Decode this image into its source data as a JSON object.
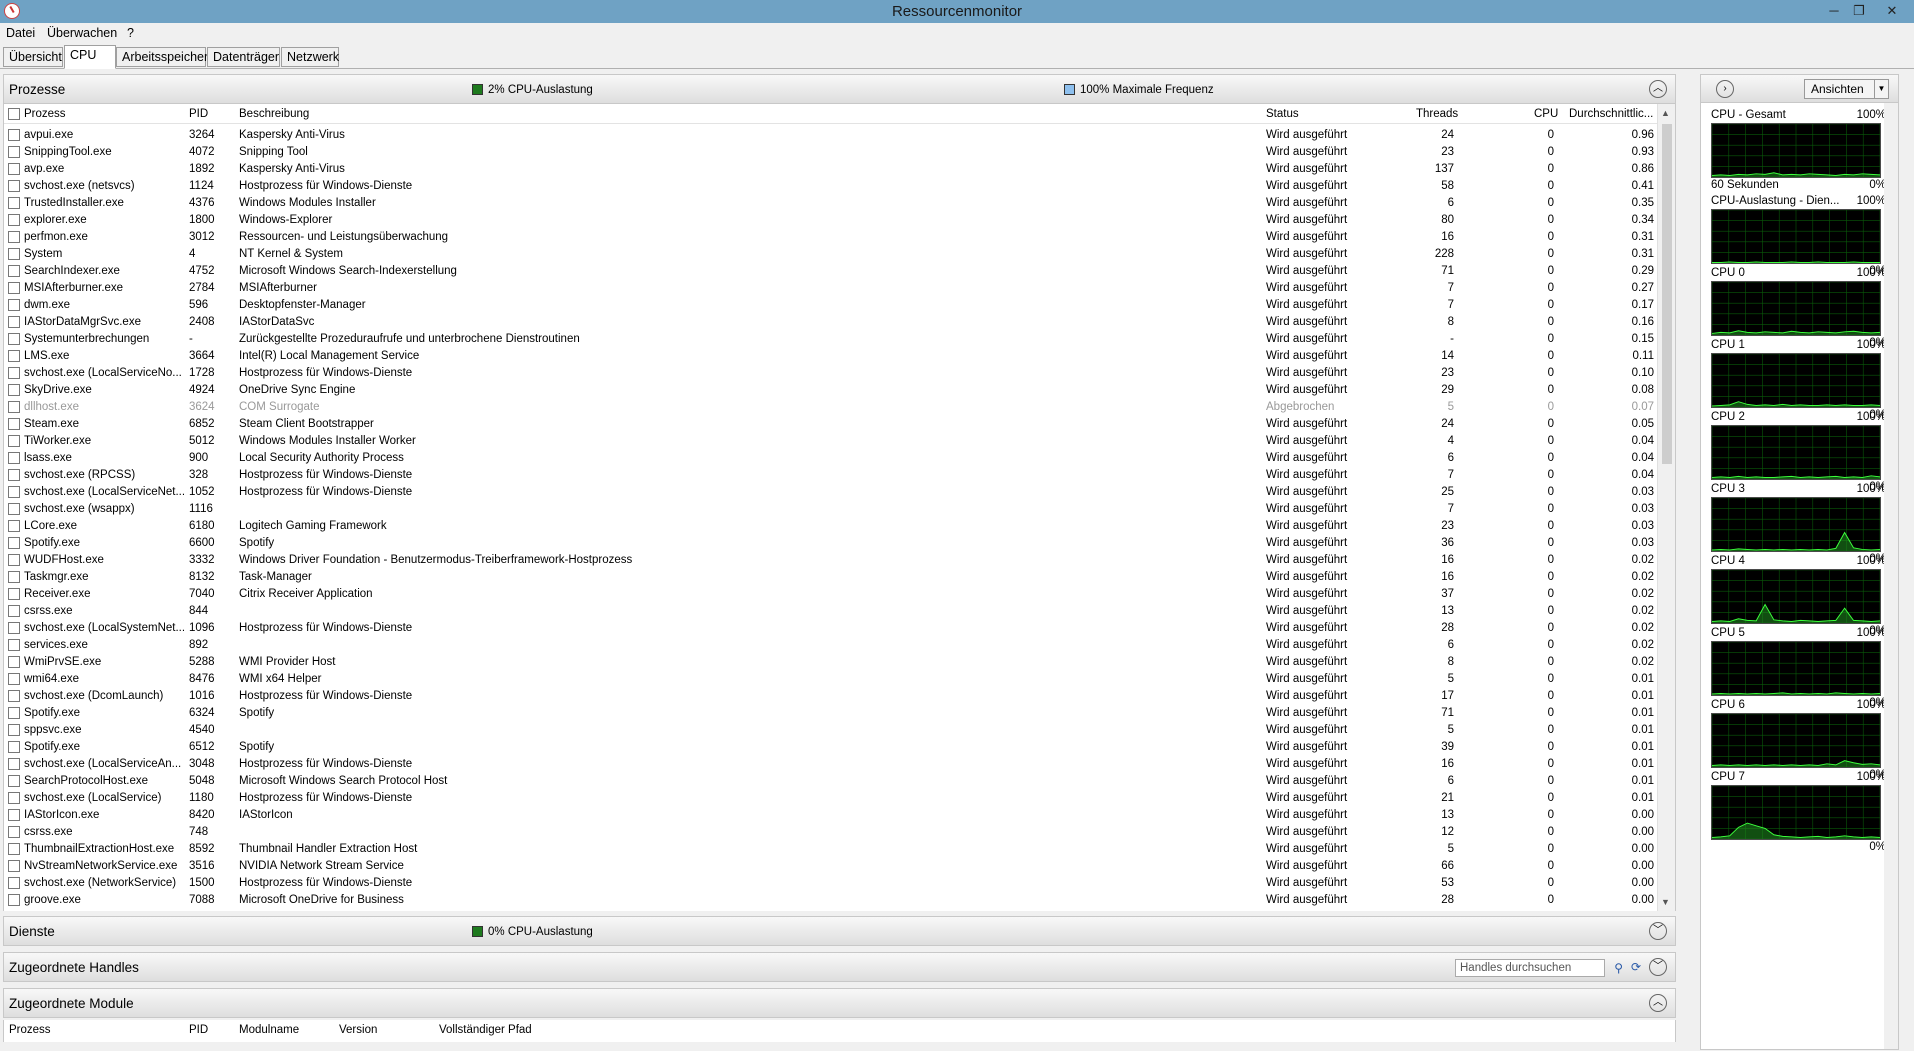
{
  "window": {
    "title": "Ressourcenmonitor",
    "minimize": "─",
    "restore": "❐",
    "close": "✕"
  },
  "menu": {
    "datei": "Datei",
    "ueberwachen": "Überwachen",
    "help": "?"
  },
  "tabs": {
    "uebersicht": "Übersicht",
    "cpu": "CPU",
    "arbeitsspeicher": "Arbeitsspeicher",
    "datentraeger": "Datenträger",
    "netzwerk": "Netzwerk"
  },
  "prozesse": {
    "title": "Prozesse",
    "cpu_load": "2% CPU-Auslastung",
    "max_freq": "100% Maximale Frequenz",
    "legend_colors": {
      "cpu": "#1e7a1e",
      "freq": "#8ec0ee"
    },
    "columns": {
      "prozess": "Prozess",
      "pid": "PID",
      "beschreibung": "Beschreibung",
      "status": "Status",
      "threads": "Threads",
      "cpu": "CPU",
      "avg": "Durchschnittlic..."
    },
    "rows": [
      {
        "p": "avpui.exe",
        "pid": "3264",
        "d": "Kaspersky Anti-Virus",
        "s": "Wird ausgeführt",
        "t": "24",
        "c": "0",
        "a": "0.96"
      },
      {
        "p": "SnippingTool.exe",
        "pid": "4072",
        "d": "Snipping Tool",
        "s": "Wird ausgeführt",
        "t": "23",
        "c": "0",
        "a": "0.93"
      },
      {
        "p": "avp.exe",
        "pid": "1892",
        "d": "Kaspersky Anti-Virus",
        "s": "Wird ausgeführt",
        "t": "137",
        "c": "0",
        "a": "0.86"
      },
      {
        "p": "svchost.exe (netsvcs)",
        "pid": "1124",
        "d": "Hostprozess für Windows-Dienste",
        "s": "Wird ausgeführt",
        "t": "58",
        "c": "0",
        "a": "0.41"
      },
      {
        "p": "TrustedInstaller.exe",
        "pid": "4376",
        "d": "Windows Modules Installer",
        "s": "Wird ausgeführt",
        "t": "6",
        "c": "0",
        "a": "0.35"
      },
      {
        "p": "explorer.exe",
        "pid": "1800",
        "d": "Windows-Explorer",
        "s": "Wird ausgeführt",
        "t": "80",
        "c": "0",
        "a": "0.34"
      },
      {
        "p": "perfmon.exe",
        "pid": "3012",
        "d": "Ressourcen- und Leistungsüberwachung",
        "s": "Wird ausgeführt",
        "t": "16",
        "c": "0",
        "a": "0.31"
      },
      {
        "p": "System",
        "pid": "4",
        "d": "NT Kernel & System",
        "s": "Wird ausgeführt",
        "t": "228",
        "c": "0",
        "a": "0.31"
      },
      {
        "p": "SearchIndexer.exe",
        "pid": "4752",
        "d": "Microsoft Windows Search-Indexerstellung",
        "s": "Wird ausgeführt",
        "t": "71",
        "c": "0",
        "a": "0.29"
      },
      {
        "p": "MSIAfterburner.exe",
        "pid": "2784",
        "d": "MSIAfterburner",
        "s": "Wird ausgeführt",
        "t": "7",
        "c": "0",
        "a": "0.27"
      },
      {
        "p": "dwm.exe",
        "pid": "596",
        "d": "Desktopfenster-Manager",
        "s": "Wird ausgeführt",
        "t": "7",
        "c": "0",
        "a": "0.17"
      },
      {
        "p": "IAStorDataMgrSvc.exe",
        "pid": "2408",
        "d": "IAStorDataSvc",
        "s": "Wird ausgeführt",
        "t": "8",
        "c": "0",
        "a": "0.16"
      },
      {
        "p": "Systemunterbrechungen",
        "pid": "-",
        "d": "Zurückgestellte Prozeduraufrufe und unterbrochene Dienstroutinen",
        "s": "Wird ausgeführt",
        "t": "-",
        "c": "0",
        "a": "0.15"
      },
      {
        "p": "LMS.exe",
        "pid": "3664",
        "d": "Intel(R) Local Management Service",
        "s": "Wird ausgeführt",
        "t": "14",
        "c": "0",
        "a": "0.11"
      },
      {
        "p": "svchost.exe (LocalServiceNo...",
        "pid": "1728",
        "d": "Hostprozess für Windows-Dienste",
        "s": "Wird ausgeführt",
        "t": "23",
        "c": "0",
        "a": "0.10"
      },
      {
        "p": "SkyDrive.exe",
        "pid": "4924",
        "d": "OneDrive Sync Engine",
        "s": "Wird ausgeführt",
        "t": "29",
        "c": "0",
        "a": "0.08"
      },
      {
        "p": "dllhost.exe",
        "pid": "3624",
        "d": "COM Surrogate",
        "s": "Abgebrochen",
        "t": "5",
        "c": "0",
        "a": "0.07",
        "dim": true
      },
      {
        "p": "Steam.exe",
        "pid": "6852",
        "d": "Steam Client Bootstrapper",
        "s": "Wird ausgeführt",
        "t": "24",
        "c": "0",
        "a": "0.05"
      },
      {
        "p": "TiWorker.exe",
        "pid": "5012",
        "d": "Windows Modules Installer Worker",
        "s": "Wird ausgeführt",
        "t": "4",
        "c": "0",
        "a": "0.04"
      },
      {
        "p": "lsass.exe",
        "pid": "900",
        "d": "Local Security Authority Process",
        "s": "Wird ausgeführt",
        "t": "6",
        "c": "0",
        "a": "0.04"
      },
      {
        "p": "svchost.exe (RPCSS)",
        "pid": "328",
        "d": "Hostprozess für Windows-Dienste",
        "s": "Wird ausgeführt",
        "t": "7",
        "c": "0",
        "a": "0.04"
      },
      {
        "p": "svchost.exe (LocalServiceNet...",
        "pid": "1052",
        "d": "Hostprozess für Windows-Dienste",
        "s": "Wird ausgeführt",
        "t": "25",
        "c": "0",
        "a": "0.03"
      },
      {
        "p": "svchost.exe (wsappx)",
        "pid": "1116",
        "d": "",
        "s": "Wird ausgeführt",
        "t": "7",
        "c": "0",
        "a": "0.03"
      },
      {
        "p": "LCore.exe",
        "pid": "6180",
        "d": "Logitech Gaming Framework",
        "s": "Wird ausgeführt",
        "t": "23",
        "c": "0",
        "a": "0.03"
      },
      {
        "p": "Spotify.exe",
        "pid": "6600",
        "d": "Spotify",
        "s": "Wird ausgeführt",
        "t": "36",
        "c": "0",
        "a": "0.03"
      },
      {
        "p": "WUDFHost.exe",
        "pid": "3332",
        "d": "Windows Driver Foundation - Benutzermodus-Treiberframework-Hostprozess",
        "s": "Wird ausgeführt",
        "t": "16",
        "c": "0",
        "a": "0.02"
      },
      {
        "p": "Taskmgr.exe",
        "pid": "8132",
        "d": "Task-Manager",
        "s": "Wird ausgeführt",
        "t": "16",
        "c": "0",
        "a": "0.02"
      },
      {
        "p": "Receiver.exe",
        "pid": "7040",
        "d": "Citrix Receiver Application",
        "s": "Wird ausgeführt",
        "t": "37",
        "c": "0",
        "a": "0.02"
      },
      {
        "p": "csrss.exe",
        "pid": "844",
        "d": "",
        "s": "Wird ausgeführt",
        "t": "13",
        "c": "0",
        "a": "0.02"
      },
      {
        "p": "svchost.exe (LocalSystemNet...",
        "pid": "1096",
        "d": "Hostprozess für Windows-Dienste",
        "s": "Wird ausgeführt",
        "t": "28",
        "c": "0",
        "a": "0.02"
      },
      {
        "p": "services.exe",
        "pid": "892",
        "d": "",
        "s": "Wird ausgeführt",
        "t": "6",
        "c": "0",
        "a": "0.02"
      },
      {
        "p": "WmiPrvSE.exe",
        "pid": "5288",
        "d": "WMI Provider Host",
        "s": "Wird ausgeführt",
        "t": "8",
        "c": "0",
        "a": "0.02"
      },
      {
        "p": "wmi64.exe",
        "pid": "8476",
        "d": "WMI x64 Helper",
        "s": "Wird ausgeführt",
        "t": "5",
        "c": "0",
        "a": "0.01"
      },
      {
        "p": "svchost.exe (DcomLaunch)",
        "pid": "1016",
        "d": "Hostprozess für Windows-Dienste",
        "s": "Wird ausgeführt",
        "t": "17",
        "c": "0",
        "a": "0.01"
      },
      {
        "p": "Spotify.exe",
        "pid": "6324",
        "d": "Spotify",
        "s": "Wird ausgeführt",
        "t": "71",
        "c": "0",
        "a": "0.01"
      },
      {
        "p": "sppsvc.exe",
        "pid": "4540",
        "d": "",
        "s": "Wird ausgeführt",
        "t": "5",
        "c": "0",
        "a": "0.01"
      },
      {
        "p": "Spotify.exe",
        "pid": "6512",
        "d": "Spotify",
        "s": "Wird ausgeführt",
        "t": "39",
        "c": "0",
        "a": "0.01"
      },
      {
        "p": "svchost.exe (LocalServiceAn...",
        "pid": "3048",
        "d": "Hostprozess für Windows-Dienste",
        "s": "Wird ausgeführt",
        "t": "16",
        "c": "0",
        "a": "0.01"
      },
      {
        "p": "SearchProtocolHost.exe",
        "pid": "5048",
        "d": "Microsoft Windows Search Protocol Host",
        "s": "Wird ausgeführt",
        "t": "6",
        "c": "0",
        "a": "0.01"
      },
      {
        "p": "svchost.exe (LocalService)",
        "pid": "1180",
        "d": "Hostprozess für Windows-Dienste",
        "s": "Wird ausgeführt",
        "t": "21",
        "c": "0",
        "a": "0.01"
      },
      {
        "p": "IAStorIcon.exe",
        "pid": "8420",
        "d": "IAStorIcon",
        "s": "Wird ausgeführt",
        "t": "13",
        "c": "0",
        "a": "0.00"
      },
      {
        "p": "csrss.exe",
        "pid": "748",
        "d": "",
        "s": "Wird ausgeführt",
        "t": "12",
        "c": "0",
        "a": "0.00"
      },
      {
        "p": "ThumbnailExtractionHost.exe",
        "pid": "8592",
        "d": "Thumbnail Handler Extraction Host",
        "s": "Wird ausgeführt",
        "t": "5",
        "c": "0",
        "a": "0.00"
      },
      {
        "p": "NvStreamNetworkService.exe",
        "pid": "3516",
        "d": "NVIDIA Network Stream Service",
        "s": "Wird ausgeführt",
        "t": "66",
        "c": "0",
        "a": "0.00"
      },
      {
        "p": "svchost.exe (NetworkService)",
        "pid": "1500",
        "d": "Hostprozess für Windows-Dienste",
        "s": "Wird ausgeführt",
        "t": "53",
        "c": "0",
        "a": "0.00"
      },
      {
        "p": "groove.exe",
        "pid": "7088",
        "d": "Microsoft OneDrive for Business",
        "s": "Wird ausgeführt",
        "t": "28",
        "c": "0",
        "a": "0.00"
      }
    ]
  },
  "dienste": {
    "title": "Dienste",
    "cpu_load": "0% CPU-Auslastung"
  },
  "handles": {
    "title": "Zugeordnete Handles",
    "search_placeholder": "Handles durchsuchen"
  },
  "module": {
    "title": "Zugeordnete Module",
    "columns": {
      "prozess": "Prozess",
      "pid": "PID",
      "modulname": "Modulname",
      "version": "Version",
      "pfad": "Vollständiger Pfad"
    }
  },
  "right": {
    "ansichten": "Ansichten",
    "graphs": [
      {
        "label": "CPU - Gesamt",
        "max": "100%",
        "min": "0%",
        "sub": "60 Sekunden",
        "levels": [
          3,
          4,
          3,
          5,
          4,
          6,
          5,
          8,
          4,
          5,
          4,
          6,
          5,
          4,
          3,
          5,
          4,
          6,
          5,
          4
        ]
      },
      {
        "label": "CPU-Auslastung - Dien...",
        "max": "100%",
        "min": "0%",
        "levels": [
          1,
          1,
          2,
          1,
          1,
          2,
          1,
          1,
          1,
          2,
          1,
          1,
          2,
          1,
          1,
          1,
          2,
          1,
          1,
          1
        ]
      },
      {
        "label": "CPU 0",
        "max": "100%",
        "min": "0%",
        "levels": [
          3,
          5,
          4,
          8,
          5,
          4,
          6,
          5,
          4,
          7,
          5,
          4,
          6,
          5,
          4,
          6,
          7,
          5,
          4,
          5
        ]
      },
      {
        "label": "CPU 1",
        "max": "100%",
        "min": "0%",
        "levels": [
          2,
          3,
          4,
          10,
          5,
          3,
          4,
          3,
          5,
          3,
          4,
          3,
          3,
          4,
          3,
          4,
          3,
          3,
          4,
          3
        ]
      },
      {
        "label": "CPU 2",
        "max": "100%",
        "min": "0%",
        "levels": [
          3,
          4,
          3,
          5,
          3,
          4,
          3,
          3,
          4,
          5,
          3,
          4,
          3,
          4,
          5,
          3,
          4,
          3,
          6,
          4
        ]
      },
      {
        "label": "CPU 3",
        "max": "100%",
        "min": "0%",
        "levels": [
          2,
          3,
          2,
          4,
          3,
          2,
          3,
          2,
          3,
          2,
          3,
          2,
          3,
          2,
          5,
          35,
          6,
          3,
          2,
          3
        ]
      },
      {
        "label": "CPU 4",
        "max": "100%",
        "min": "0%",
        "levels": [
          3,
          4,
          3,
          8,
          5,
          4,
          35,
          6,
          4,
          3,
          5,
          4,
          3,
          4,
          5,
          28,
          5,
          4,
          3,
          4
        ]
      },
      {
        "label": "CPU 5",
        "max": "100%",
        "min": "0%",
        "levels": [
          2,
          3,
          2,
          3,
          2,
          3,
          2,
          3,
          4,
          2,
          3,
          2,
          3,
          2,
          4,
          3,
          2,
          3,
          2,
          3
        ]
      },
      {
        "label": "CPU 6",
        "max": "100%",
        "min": "0%",
        "levels": [
          3,
          4,
          3,
          4,
          3,
          4,
          3,
          4,
          3,
          4,
          3,
          4,
          3,
          6,
          4,
          12,
          8,
          5,
          6,
          4
        ]
      },
      {
        "label": "CPU 7",
        "max": "100%",
        "min": "0%",
        "levels": [
          3,
          4,
          6,
          22,
          30,
          25,
          20,
          8,
          5,
          4,
          3,
          4,
          5,
          3,
          4,
          6,
          4,
          3,
          4,
          3
        ]
      }
    ]
  }
}
